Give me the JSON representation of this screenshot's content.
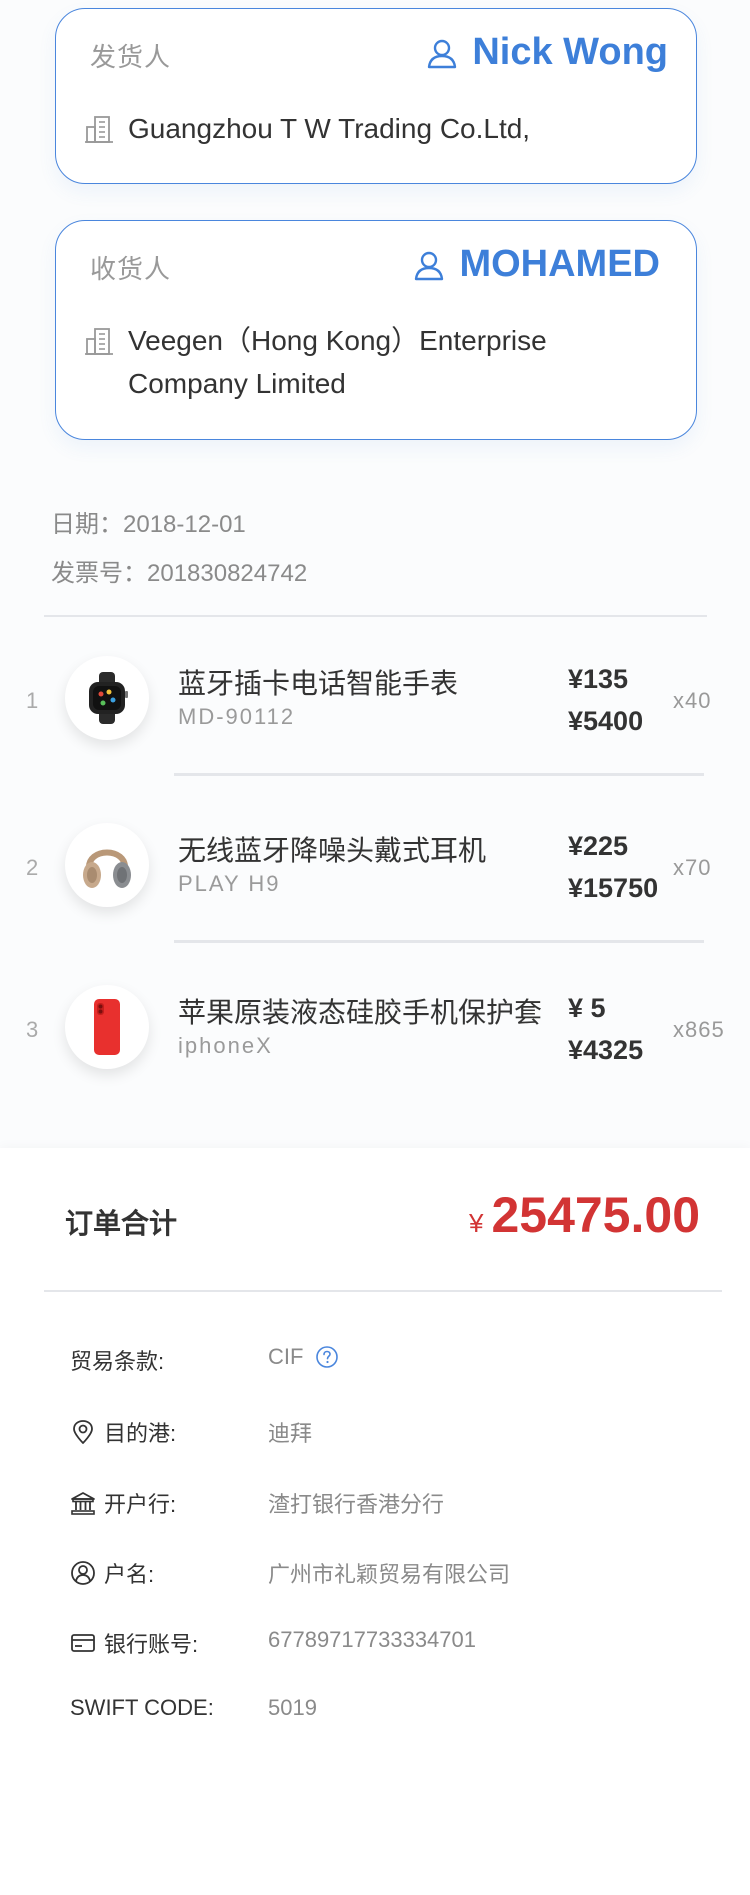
{
  "sender": {
    "label": "发货人",
    "name": "Nick Wong",
    "company": "Guangzhou T W Trading Co.Ltd,"
  },
  "receiver": {
    "label": "收货人",
    "name": "MOHAMED",
    "company": "Veegen（Hong Kong）Enterprise Company Limited"
  },
  "invoice": {
    "date_label": "日期：2018-12-01",
    "number_label": "发票号：201830824742"
  },
  "items": [
    {
      "index": "1",
      "name": "蓝牙插卡电话智能手表",
      "sku": "MD-90112",
      "unit_price": "¥135",
      "total_price": "¥5400",
      "qty": "x40",
      "thumb_icon": "smartwatch-icon"
    },
    {
      "index": "2",
      "name": "无线蓝牙降噪头戴式耳机",
      "sku": "PLAY H9",
      "unit_price": "¥225",
      "total_price": "¥15750",
      "qty": "x70",
      "thumb_icon": "headphones-icon"
    },
    {
      "index": "3",
      "name": "苹果原装液态硅胶手机保护套",
      "sku": "iphoneX",
      "unit_price": "¥ 5",
      "total_price": "¥4325",
      "qty": "x865",
      "thumb_icon": "phone-case-icon"
    }
  ],
  "summary": {
    "label": "订单合计",
    "currency": "¥",
    "amount": "25475.00"
  },
  "details": {
    "trade_terms": {
      "label": "贸易条款:",
      "value": "CIF",
      "icon": "help-icon"
    },
    "destination_port": {
      "label": "目的港:",
      "value": "迪拜",
      "icon": "location-pin-icon"
    },
    "bank": {
      "label": "开户行:",
      "value": "渣打银行香港分行",
      "icon": "bank-icon"
    },
    "account_name": {
      "label": "户名:",
      "value": "广州市礼颖贸易有限公司",
      "icon": "user-circle-icon"
    },
    "account_number": {
      "label": "银行账号:",
      "value": "67789717733334701",
      "icon": "card-icon"
    },
    "swift_code": {
      "label": "SWIFT CODE:",
      "value": "5019"
    }
  },
  "colors": {
    "accent": "#3d7fd9",
    "price_red": "#d23434",
    "text_primary": "#333333",
    "text_secondary": "#999999"
  }
}
